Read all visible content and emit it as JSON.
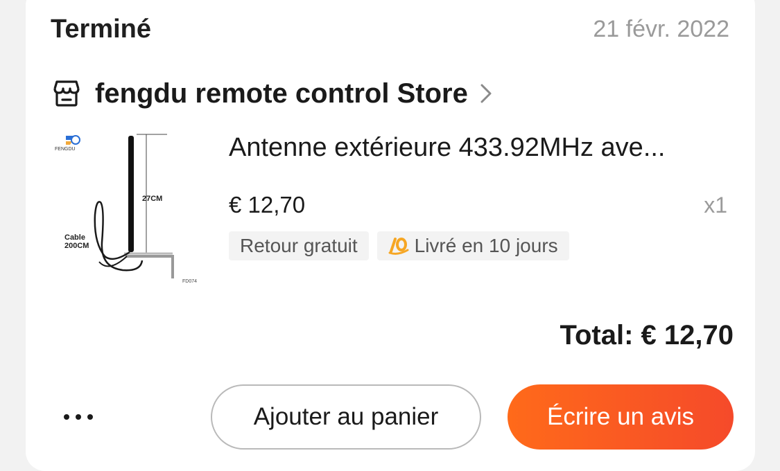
{
  "order": {
    "status": "Terminé",
    "date": "21 févr. 2022"
  },
  "store": {
    "name": "fengdu remote control Store",
    "icon": "store-icon"
  },
  "product": {
    "title": "Antenne extérieure 433.92MHz ave...",
    "price": "€ 12,70",
    "quantity": "x1",
    "image_labels": {
      "brand": "FENGDU",
      "length": "27CM",
      "cable_line1": "Cable",
      "cable_line2": "200CM",
      "code": "FD074"
    },
    "tags": [
      {
        "label": "Retour gratuit"
      },
      {
        "label": "Livré en 10 jours",
        "icon": "delivery-10-days-icon"
      }
    ]
  },
  "total": "Total: € 12,70",
  "actions": {
    "more_icon": "more-options-icon",
    "add_to_cart": "Ajouter au panier",
    "write_review": "Écrire un avis"
  },
  "colors": {
    "accent_start": "#ff6a1a",
    "accent_end": "#f54a2a",
    "tag_icon": "#f6a623",
    "muted_text": "#9a9a9a"
  }
}
